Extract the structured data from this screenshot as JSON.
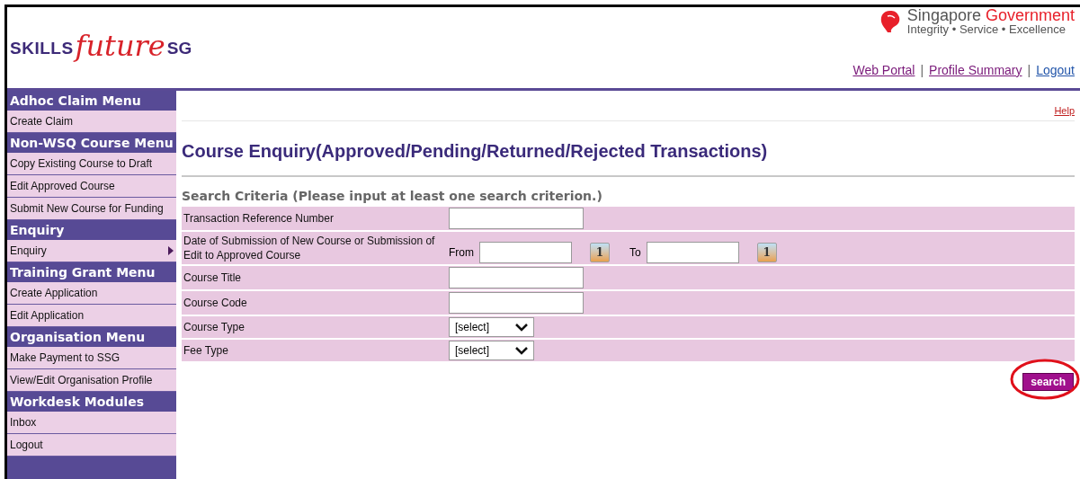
{
  "header": {
    "logo": {
      "left": "SKILLS",
      "middle": "future",
      "right": "SG"
    },
    "gov_brand": {
      "name_first": "Singapore",
      "name_second": "Government",
      "tagline": "Integrity • Service • Excellence"
    },
    "links": [
      {
        "label": "Web Portal"
      },
      {
        "label": "Profile Summary"
      },
      {
        "label": "Logout"
      }
    ],
    "separator": "|"
  },
  "sidebar": {
    "sections": [
      {
        "title": "Adhoc Claim Menu",
        "items": [
          {
            "label": "Create Claim",
            "has_submenu": false
          }
        ]
      },
      {
        "title": "Non-WSQ Course Menu",
        "items": [
          {
            "label": "Copy Existing Course to Draft",
            "has_submenu": false
          },
          {
            "label": "Edit Approved Course",
            "has_submenu": false
          },
          {
            "label": "Submit New Course for Funding",
            "has_submenu": false
          }
        ]
      },
      {
        "title": "Enquiry",
        "items": [
          {
            "label": "Enquiry",
            "has_submenu": true
          }
        ]
      },
      {
        "title": "Training Grant Menu",
        "items": [
          {
            "label": "Create Application",
            "has_submenu": false
          },
          {
            "label": "Edit Application",
            "has_submenu": false
          }
        ]
      },
      {
        "title": "Organisation Menu",
        "items": [
          {
            "label": "Make Payment to SSG",
            "has_submenu": false
          },
          {
            "label": "View/Edit Organisation Profile",
            "has_submenu": false
          }
        ]
      },
      {
        "title": "Workdesk Modules",
        "items": [
          {
            "label": "Inbox",
            "has_submenu": false
          },
          {
            "label": "Logout",
            "has_submenu": false
          }
        ]
      }
    ]
  },
  "content": {
    "help_link": "Help",
    "title": "Course Enquiry(Approved/Pending/Returned/Rejected Transactions)",
    "criteria_heading": "Search Criteria (Please input at least one search criterion.)",
    "rows": [
      {
        "kind": "text",
        "label": "Transaction Reference Number"
      },
      {
        "kind": "date_range",
        "label": "Date of Submission of New  Course or Submission of Edit to Approved Course",
        "from_label": "From",
        "to_label": "To",
        "from_icon_text": "1",
        "to_icon_text": "1"
      },
      {
        "kind": "text",
        "label": "Course Title"
      },
      {
        "kind": "text",
        "label": "Course Code"
      },
      {
        "kind": "select",
        "label": "Course Type",
        "value": "[select]"
      },
      {
        "kind": "select",
        "label": "Fee Type",
        "value": "[select]"
      }
    ],
    "search_button": "search",
    "search_highlighted": true
  }
}
